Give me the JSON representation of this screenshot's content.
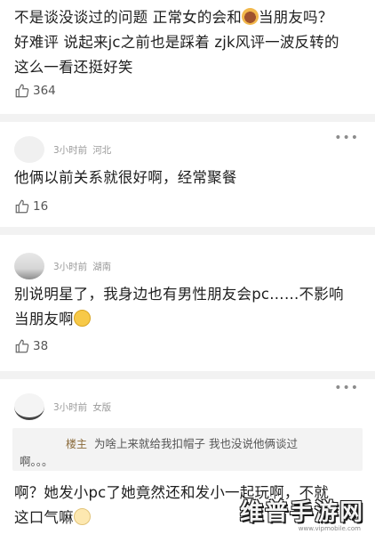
{
  "posts": [
    {
      "lines": [
        "不是谈没谈过的问题 正常女的会和",
        "当朋友吗？",
        "好难评 说起来jc之前也是踩着 zjk风评一波反转的",
        "这么一看还挺好笑"
      ],
      "likes": "364"
    },
    {
      "time": "3小时前",
      "location": "河北",
      "text": "他俩以前关系就很好啊，经常聚餐",
      "likes": "16"
    },
    {
      "time": "3小时前",
      "location": "湖南",
      "text1": "别说明星了，我身边也有男性朋友会pc……不影响",
      "text2": "当朋友啊",
      "likes": "38"
    },
    {
      "time": "3小时前",
      "location": "女版",
      "quote_label": "楼主",
      "quote_line1": "为啥上来就给我扣帽子 我也没说他俩谈过",
      "quote_line2": "啊。。。",
      "text1": "啊？她发小pc了她竟然还和发小一起玩啊，不就",
      "text2": "这口气嘛"
    }
  ],
  "more_label": "•••",
  "icons": {
    "like": "thumbs-up-icon",
    "more": "more-dots-icon"
  },
  "watermark": {
    "text": "维普手游网",
    "sub": "www.vipmobile.com"
  }
}
